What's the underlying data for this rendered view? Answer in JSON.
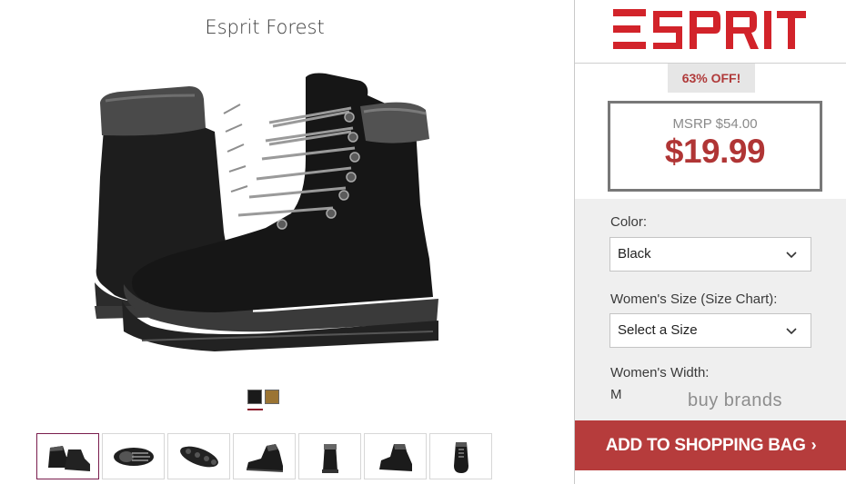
{
  "product": {
    "title": "Esprit Forest",
    "image_alt_icon": "black-lace-up-boots-image",
    "swatches": [
      {
        "name": "black-swatch",
        "color": "#1a1a1a"
      },
      {
        "name": "tan-swatch",
        "color": "#9b7433"
      }
    ],
    "thumbnails": [
      {
        "name": "thumb-pair-view",
        "active": true
      },
      {
        "name": "thumb-top-view",
        "active": false
      },
      {
        "name": "thumb-sole-view",
        "active": false
      },
      {
        "name": "thumb-side-view",
        "active": false
      },
      {
        "name": "thumb-back-view",
        "active": false
      },
      {
        "name": "thumb-angle-view",
        "active": false
      },
      {
        "name": "thumb-front-view",
        "active": false
      }
    ]
  },
  "panel": {
    "brand_logo_text": "ESPRIT",
    "brand_color": "#d2232a",
    "discount": "63% OFF!",
    "msrp": "MSRP $54.00",
    "price": "$19.99",
    "color_label": "Color:",
    "color_value": "Black",
    "size_label": "Women's Size (Size Chart):",
    "size_value": "Select a Size",
    "width_label": "Women's Width:",
    "width_value": "M",
    "watermark": "buy brands",
    "add_to_bag": "ADD TO SHOPPING BAG",
    "add_to_bag_arrow": "›",
    "button_color": "#b63c3c"
  }
}
